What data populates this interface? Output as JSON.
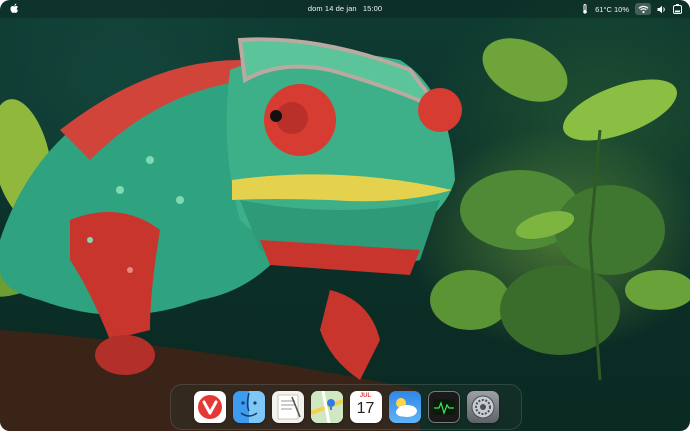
{
  "menubar": {
    "date": "dom 14 de jan",
    "time": "15:00",
    "temperature": "61°C",
    "battery": "10%"
  },
  "dock": {
    "items": [
      {
        "name": "Vivaldi",
        "icon": "vivaldi-icon"
      },
      {
        "name": "Finder",
        "icon": "finder-icon"
      },
      {
        "name": "TextEdit",
        "icon": "textedit-icon"
      },
      {
        "name": "Maps",
        "icon": "maps-icon"
      },
      {
        "name": "Calendar",
        "icon": "calendar-icon"
      },
      {
        "name": "Weather",
        "icon": "weather-icon"
      },
      {
        "name": "Activity Monitor",
        "icon": "activity-monitor-icon"
      },
      {
        "name": "System Settings",
        "icon": "settings-gear-icon"
      }
    ],
    "calendar": {
      "month": "JUL",
      "day": "17"
    }
  },
  "colors": {
    "background_dark": "#0b2f28",
    "chameleon_red": "#c8352c",
    "chameleon_green": "#2fa37f",
    "leaf_green": "#7fb13c"
  }
}
